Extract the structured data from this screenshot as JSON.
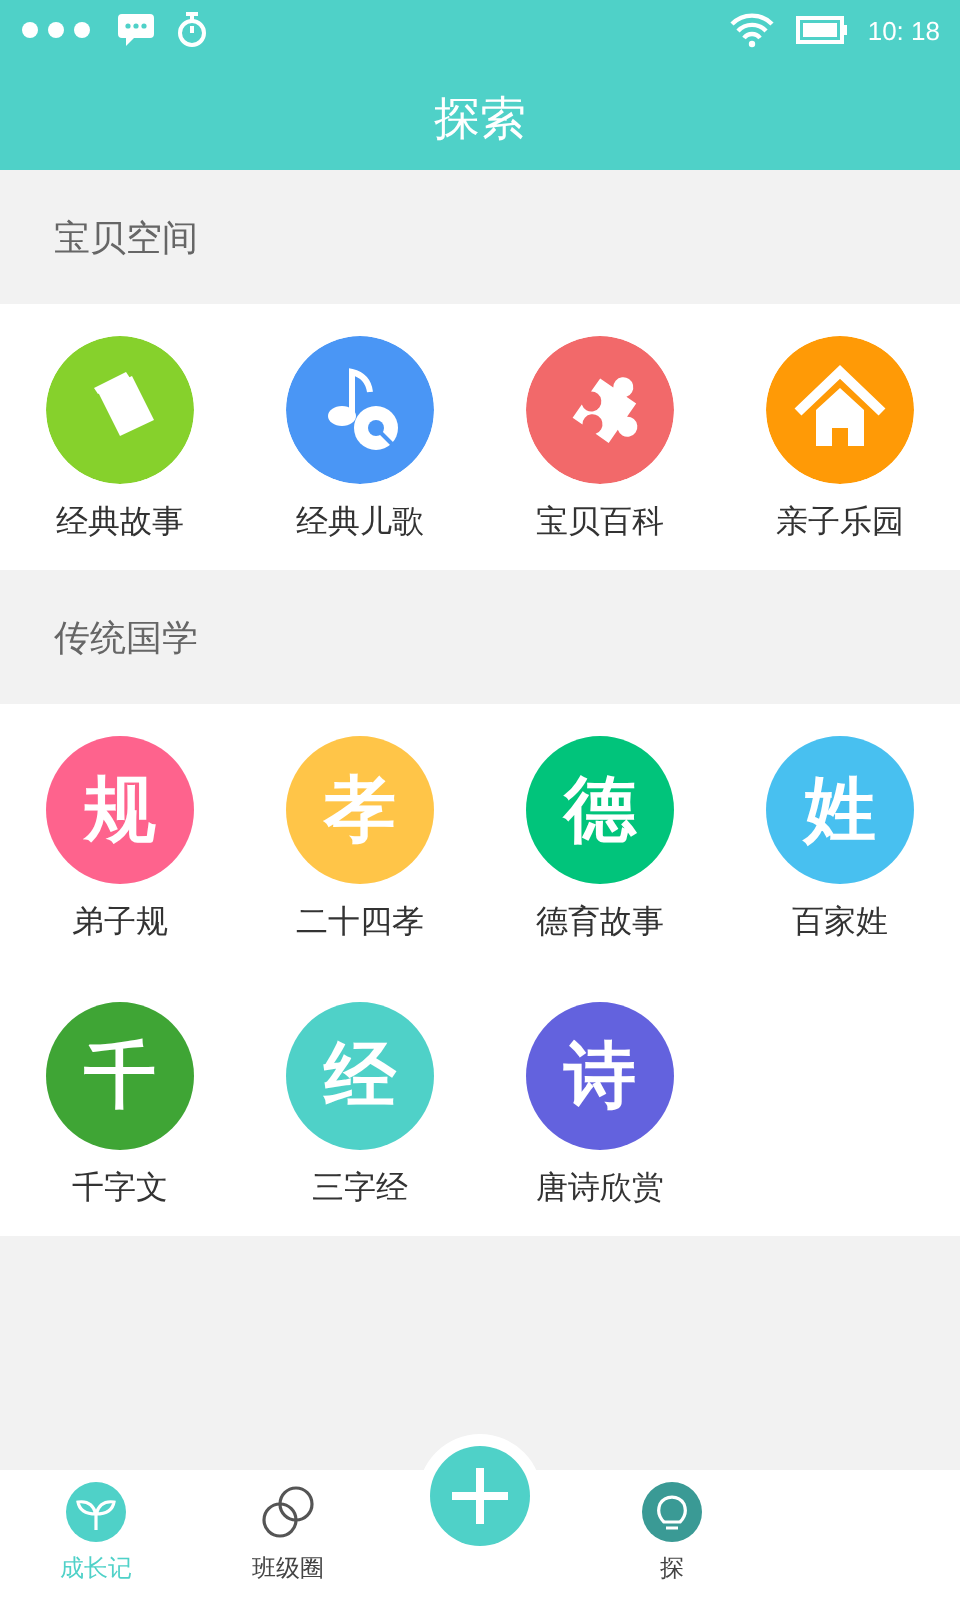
{
  "status_bar": {
    "time": "10: 18"
  },
  "header": {
    "title": "探索"
  },
  "sections": [
    {
      "title": "宝贝空间",
      "items": [
        {
          "label": "经典故事",
          "kind": "book",
          "color": "#86d12c"
        },
        {
          "label": "经典儿歌",
          "kind": "music",
          "color": "#4a96f5"
        },
        {
          "label": "宝贝百科",
          "kind": "puzzle",
          "color": "#f2696a"
        },
        {
          "label": "亲子乐园",
          "kind": "house",
          "color": "#ff9a06"
        }
      ]
    },
    {
      "title": "传统国学",
      "items": [
        {
          "label": "弟子规",
          "kind": "glyph",
          "glyph": "规",
          "color": "#fe638d"
        },
        {
          "label": "二十四孝",
          "kind": "glyph",
          "glyph": "孝",
          "color": "#ffc548"
        },
        {
          "label": "德育故事",
          "kind": "glyph",
          "glyph": "德",
          "color": "#01c47b"
        },
        {
          "label": "百家姓",
          "kind": "glyph",
          "glyph": "姓",
          "color": "#48c0f0"
        },
        {
          "label": "千字文",
          "kind": "glyph",
          "glyph": "千",
          "color": "#3fa535"
        },
        {
          "label": "三字经",
          "kind": "glyph",
          "glyph": "经",
          "color": "#4fd1c8"
        },
        {
          "label": "唐诗欣赏",
          "kind": "glyph",
          "glyph": "诗",
          "color": "#6362de"
        }
      ]
    }
  ],
  "tab_bar": [
    {
      "label": "成长记",
      "kind": "sprout",
      "selected": true
    },
    {
      "label": "班级圈",
      "kind": "rings",
      "selected": false
    },
    {
      "kind": "add"
    },
    {
      "label": "探",
      "kind": "bulb",
      "selected": false
    }
  ]
}
